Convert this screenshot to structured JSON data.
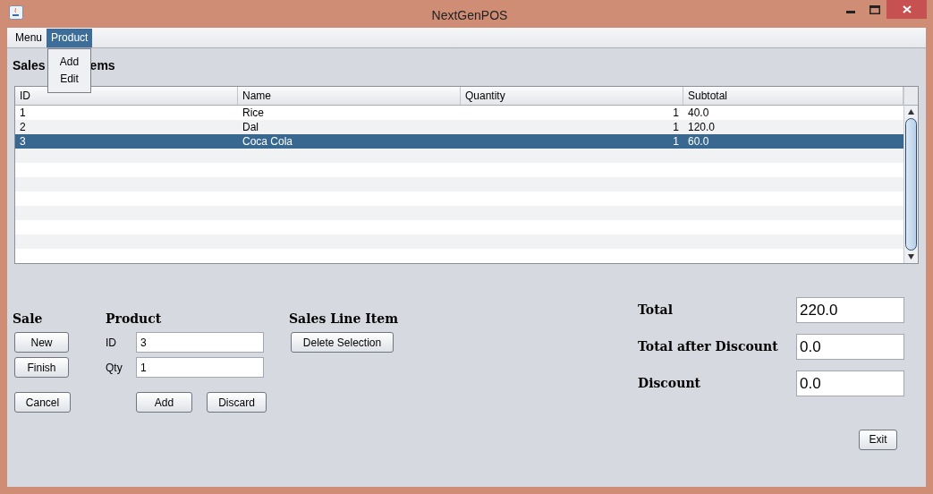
{
  "window": {
    "title": "NextGenPOS"
  },
  "menubar": [
    {
      "label": "Menu",
      "selected": false
    },
    {
      "label": "Product",
      "selected": true
    }
  ],
  "open_menu": {
    "items": [
      {
        "label": "Add"
      },
      {
        "label": "Edit"
      }
    ]
  },
  "heading_parts": [
    "Sales",
    "ems"
  ],
  "table": {
    "columns": [
      "ID",
      "Name",
      "Quantity",
      "Subtotal"
    ],
    "rows": [
      {
        "cells": [
          "1",
          "Rice",
          "1",
          "40.0"
        ],
        "selected": false
      },
      {
        "cells": [
          "2",
          "Dal",
          "1",
          "120.0"
        ],
        "selected": false
      },
      {
        "cells": [
          "3",
          "Coca Cola",
          "1",
          "60.0"
        ],
        "selected": true
      }
    ]
  },
  "sale": {
    "title": "Sale",
    "buttons": [
      "New",
      "Finish",
      "Cancel"
    ]
  },
  "product": {
    "title": "Product",
    "fields": [
      {
        "label": "ID",
        "value": "3"
      },
      {
        "label": "Qty",
        "value": "1"
      }
    ],
    "buttons": [
      "Add",
      "Discard"
    ]
  },
  "line_item": {
    "title": "Sales Line Item",
    "buttons": [
      "Delete Selection"
    ]
  },
  "totals": [
    {
      "label": "Total",
      "value": "220.0"
    },
    {
      "label": "Total after Discount",
      "value": "0.0"
    },
    {
      "label": "Discount",
      "value": "0.0"
    }
  ],
  "exit_button": "Exit"
}
